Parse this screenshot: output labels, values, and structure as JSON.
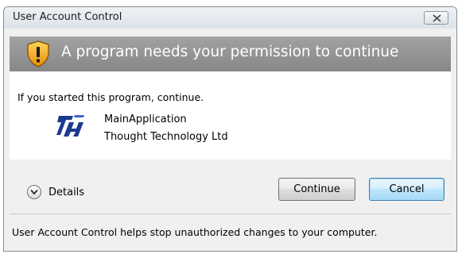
{
  "window": {
    "title": "User Account Control"
  },
  "banner": {
    "icon": "shield-warning-icon",
    "message": "A program needs your permission to continue"
  },
  "content": {
    "intro": "If you started this program, continue.",
    "program": {
      "icon": "app-logo-icon",
      "name": "MainApplication",
      "publisher": "Thought Technology Ltd"
    }
  },
  "actions": {
    "details_label": "Details",
    "continue_label": "Continue",
    "cancel_label": "Cancel"
  },
  "footer": {
    "text": "User Account Control helps stop unauthorized changes to your computer."
  },
  "colors": {
    "banner": "#8f8f8f",
    "shield": "#f0a020",
    "app_logo": "#1b3a8f"
  }
}
